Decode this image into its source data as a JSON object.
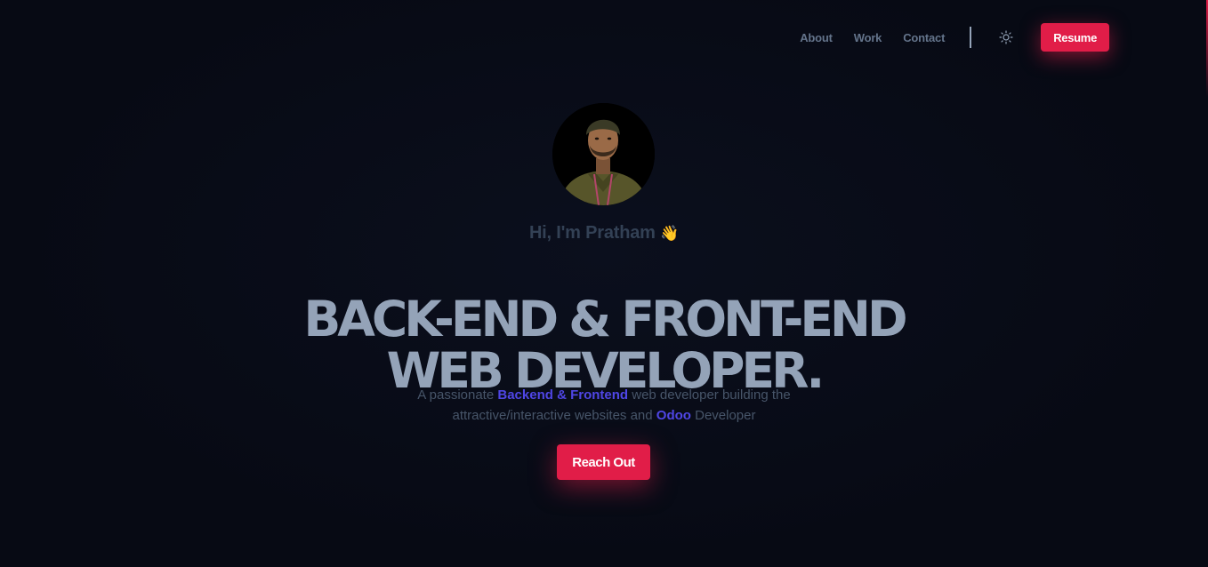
{
  "nav": {
    "links": [
      {
        "label": "About"
      },
      {
        "label": "Work"
      },
      {
        "label": "Contact"
      }
    ],
    "theme_icon": "sun-icon",
    "resume_label": "Resume"
  },
  "hero": {
    "avatar_alt": "profile-photo",
    "greeting": "Hi, I'm Pratham",
    "greeting_emoji": "👋",
    "headline_line1": "BACK-END & FRONT-END",
    "headline_line2": "WEB DEVELOPER.",
    "tagline": {
      "part1": "A passionate ",
      "highlight1": "Backend & Frontend",
      "part2": " web developer building the",
      "part3": "attractive/interactive websites and ",
      "highlight2": "Odoo",
      "part4": " Developer"
    },
    "cta_label": "Reach Out"
  },
  "colors": {
    "background": "#070a14",
    "accent": "#e11d48",
    "highlight": "#4f46e5",
    "headline": "#94a3b8"
  }
}
